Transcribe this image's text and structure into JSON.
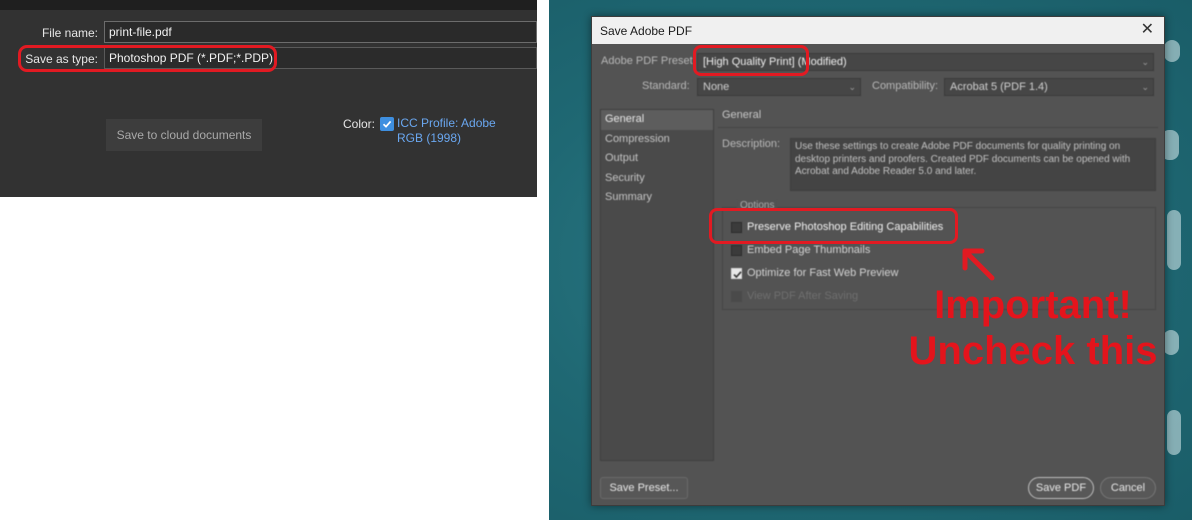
{
  "left_dialog": {
    "file_name_label": "File name:",
    "file_name_value": "print-file.pdf",
    "save_as_type_label": "Save as type:",
    "save_as_type_value": "Photoshop PDF (*.PDF;*.PDP)",
    "save_cloud_button": "Save to cloud documents",
    "color_label": "Color:",
    "icc_profile_checked": true,
    "icc_profile_text": "ICC Profile:  Adobe RGB (1998)"
  },
  "pdf_dialog": {
    "title": "Save Adobe PDF",
    "close_icon": "close-icon",
    "preset_label": "Adobe PDF Preset:",
    "preset_value": "[High Quality Print] (Modified)",
    "standard_label": "Standard:",
    "standard_value": "None",
    "compatibility_label": "Compatibility:",
    "compatibility_value": "Acrobat 5 (PDF 1.4)",
    "sidebar": [
      {
        "label": "General",
        "active": true
      },
      {
        "label": "Compression",
        "active": false
      },
      {
        "label": "Output",
        "active": false
      },
      {
        "label": "Security",
        "active": false
      },
      {
        "label": "Summary",
        "active": false
      }
    ],
    "section_heading": "General",
    "description_label": "Description:",
    "description_text": "Use these settings to create Adobe PDF documents for quality printing on desktop printers and proofers.  Created PDF documents can be opened with Acrobat and Adobe Reader 5.0 and later.",
    "options_label": "Options",
    "options": [
      {
        "label": "Preserve Photoshop Editing Capabilities",
        "checked": false,
        "enabled": true
      },
      {
        "label": "Embed Page Thumbnails",
        "checked": false,
        "enabled": true
      },
      {
        "label": "Optimize for Fast Web Preview",
        "checked": true,
        "enabled": true
      },
      {
        "label": "View PDF After Saving",
        "checked": false,
        "enabled": false
      }
    ],
    "save_preset_button": "Save Preset...",
    "save_pdf_button": "Save PDF",
    "cancel_button": "Cancel"
  },
  "annotation": {
    "line1": "Important!",
    "line2": "Uncheck this",
    "color": "#e21a22"
  },
  "colors": {
    "dialog_bg": "#535353",
    "left_bg": "#323232",
    "ocean": "#1f6873",
    "link_blue": "#6aa7f0"
  }
}
